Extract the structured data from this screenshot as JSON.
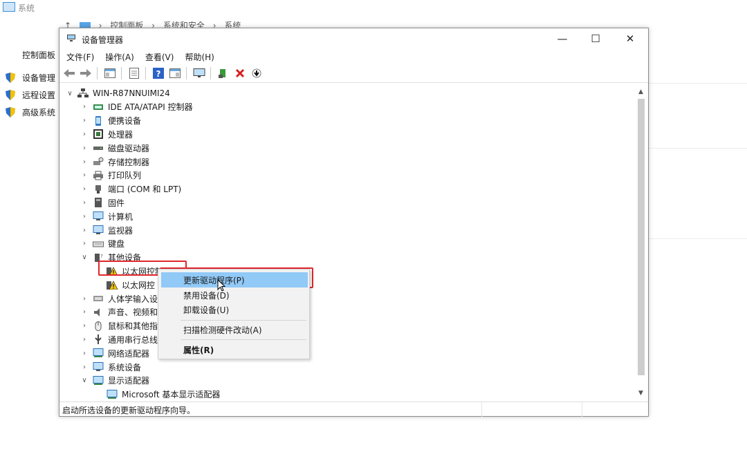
{
  "background": {
    "title": "系统",
    "breadcrumb": [
      "↑",
      "控制面板",
      "›",
      "系统和安全",
      "›",
      "系统"
    ],
    "sidebar_home": "控制面板",
    "sidebar_links": [
      "设备管理",
      "远程设置",
      "高级系统"
    ]
  },
  "window": {
    "title": "设备管理器",
    "buttons": {
      "minimize": "—",
      "maximize": "☐",
      "close": "✕"
    },
    "menu": [
      "文件(F)",
      "操作(A)",
      "查看(V)",
      "帮助(H)"
    ]
  },
  "tree": {
    "root": "WIN-R87NNUIMI24",
    "items": [
      {
        "label": "IDE ATA/ATAPI 控制器",
        "expanded": false
      },
      {
        "label": "便携设备",
        "expanded": false
      },
      {
        "label": "处理器",
        "expanded": false
      },
      {
        "label": "磁盘驱动器",
        "expanded": false
      },
      {
        "label": "存储控制器",
        "expanded": false
      },
      {
        "label": "打印队列",
        "expanded": false
      },
      {
        "label": "端口 (COM 和 LPT)",
        "expanded": false
      },
      {
        "label": "固件",
        "expanded": false
      },
      {
        "label": "计算机",
        "expanded": false
      },
      {
        "label": "监视器",
        "expanded": false
      },
      {
        "label": "键盘",
        "expanded": false
      },
      {
        "label": "其他设备",
        "expanded": true
      },
      {
        "label": "以太网控制器",
        "child": true
      },
      {
        "label": "以太网控",
        "child": true
      },
      {
        "label": "人体学输入设",
        "expanded": false
      },
      {
        "label": "声音、视频和",
        "expanded": false
      },
      {
        "label": "鼠标和其他指",
        "expanded": false
      },
      {
        "label": "通用串行总线",
        "expanded": false
      },
      {
        "label": "网络适配器",
        "expanded": false
      },
      {
        "label": "系统设备",
        "expanded": false
      },
      {
        "label": "显示适配器",
        "expanded": true
      },
      {
        "label": "Microsoft 基本显示适配器",
        "child": true
      }
    ]
  },
  "context_menu": {
    "items": [
      "更新驱动程序(P)",
      "禁用设备(D)",
      "卸载设备(U)",
      "扫描检测硬件改动(A)",
      "属性(R)"
    ],
    "selected": 0
  },
  "status": "启动所选设备的更新驱动程序向导。",
  "colors": {
    "highlight_box": "#e0262b",
    "selection": "#91c9f7"
  }
}
